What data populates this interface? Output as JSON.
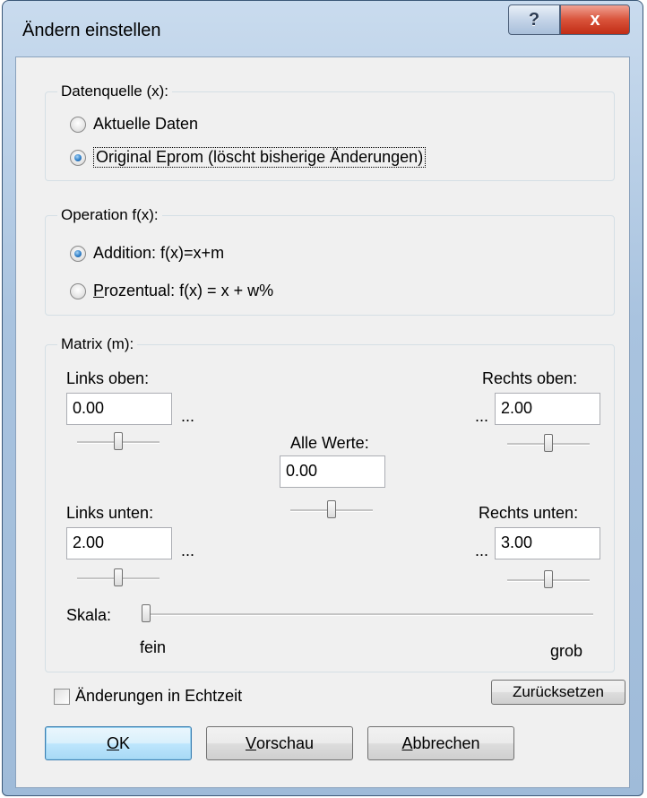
{
  "window": {
    "title": "Ändern einstellen",
    "help_label": "?",
    "close_label": "x"
  },
  "datenquelle": {
    "label": "Datenquelle (x):",
    "options": [
      {
        "label": "Aktuelle Daten",
        "checked": false
      },
      {
        "label": "Original Eprom (löscht bisherige Änderungen)",
        "checked": true
      }
    ]
  },
  "operation": {
    "label": "Operation f(x):",
    "options": [
      {
        "label": "Addition: f(x)=x+m",
        "checked": true
      },
      {
        "label_mnemonic": "P",
        "label_rest": "rozentual: f(x) = x + w%",
        "checked": false
      }
    ]
  },
  "matrix": {
    "label": "Matrix (m):",
    "links_oben": {
      "label": "Links oben:",
      "value": "0.00",
      "slider_position": 0.5
    },
    "rechts_oben": {
      "label": "Rechts oben:",
      "value": "2.00",
      "slider_position": 0.5
    },
    "alle_werte": {
      "label": "Alle Werte:",
      "value": "0.00",
      "slider_position": 0.5
    },
    "links_unten": {
      "label": "Links unten:",
      "value": "2.00",
      "slider_position": 0.5
    },
    "rechts_unten": {
      "label": "Rechts unten:",
      "value": "3.00",
      "slider_position": 0.5
    },
    "ellipsis": "...",
    "skala": {
      "label": "Skala:",
      "min_label": "fein",
      "max_label": "grob",
      "position": 0.0
    }
  },
  "echtzeit": {
    "label": "Änderungen in Echtzeit",
    "checked": false
  },
  "buttons": {
    "reset": "Zurücksetzen",
    "ok_mnemonic": "O",
    "ok_rest": "K",
    "preview_mnemonic": "V",
    "preview_rest": "orschau",
    "cancel_mnemonic": "A",
    "cancel_rest": "bbrechen"
  }
}
